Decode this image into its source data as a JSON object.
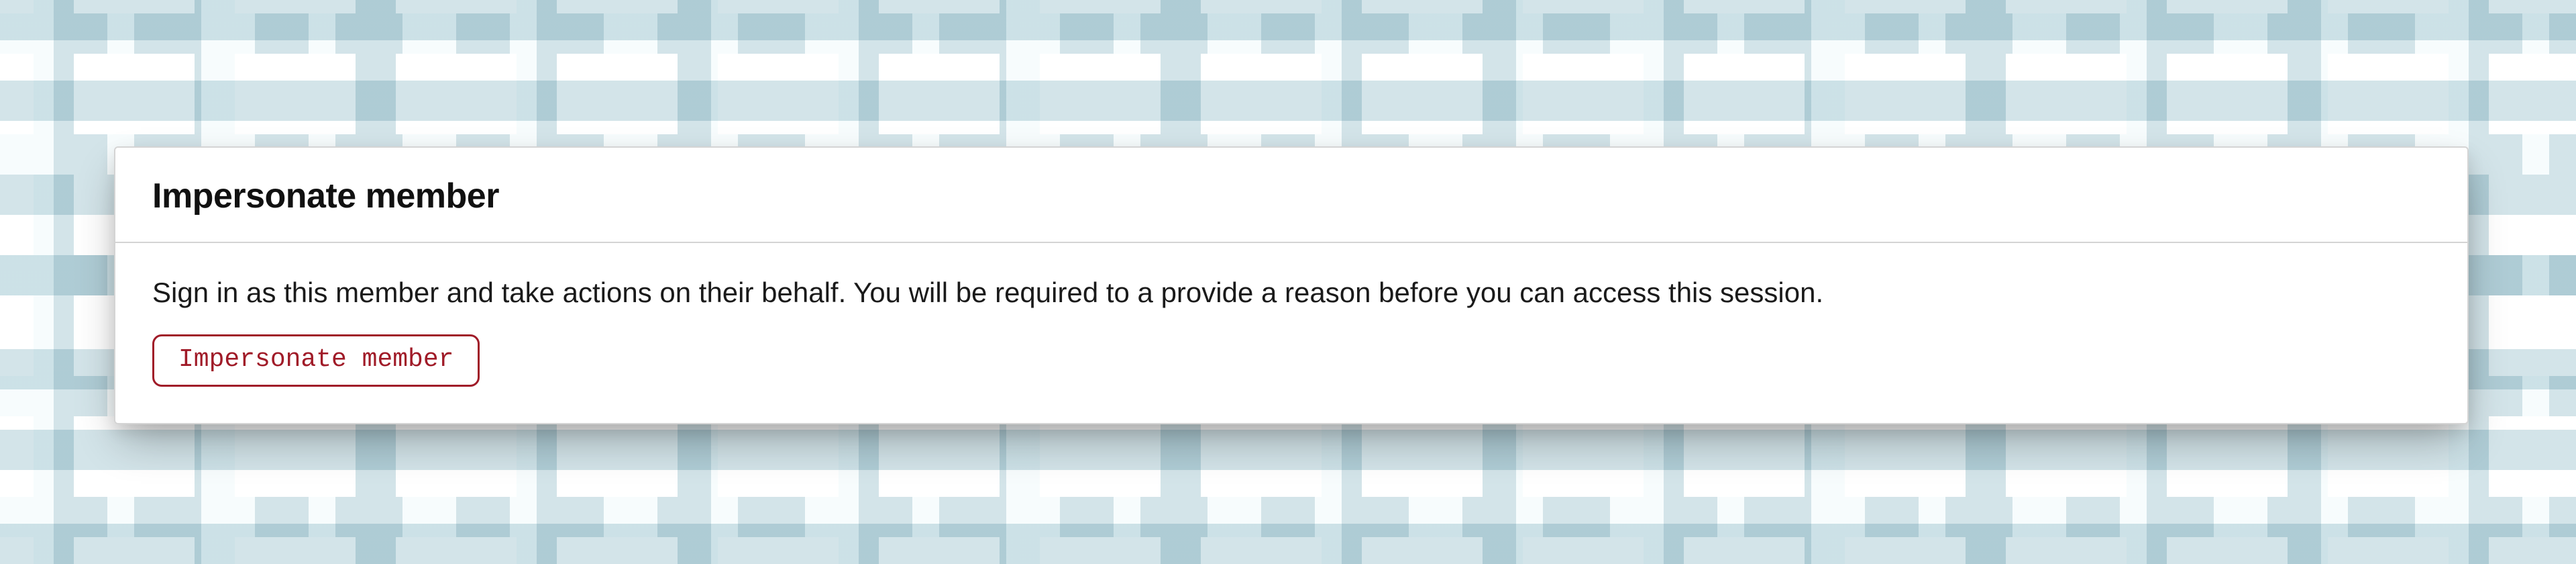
{
  "panel": {
    "title": "Impersonate member",
    "description": "Sign in as this member and take actions on their behalf. You will be required to a provide a reason before you can access this session.",
    "button_label": "Impersonate member"
  }
}
